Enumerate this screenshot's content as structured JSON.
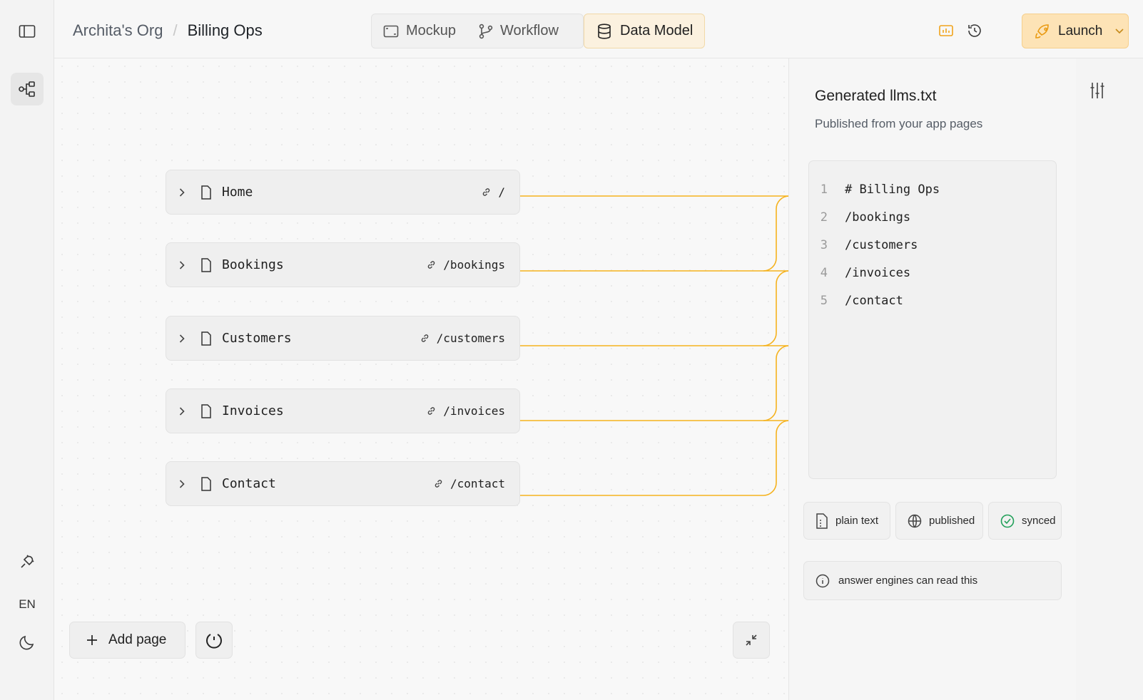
{
  "breadcrumb": {
    "org": "Archita's Org",
    "separator": "/",
    "project": "Billing Ops"
  },
  "tabs": [
    {
      "label": "Mockup",
      "icon": "mockup-icon"
    },
    {
      "label": "Workflow",
      "icon": "workflow-icon"
    },
    {
      "label": "Data Model",
      "icon": "database-icon",
      "active": true
    }
  ],
  "toolbar": {
    "launch_label": "Launch"
  },
  "rail": {
    "language": "EN"
  },
  "pages": [
    {
      "name": "Home",
      "route": "/"
    },
    {
      "name": "Bookings",
      "route": "/bookings"
    },
    {
      "name": "Customers",
      "route": "/customers"
    },
    {
      "name": "Invoices",
      "route": "/invoices"
    },
    {
      "name": "Contact",
      "route": "/contact"
    }
  ],
  "canvas": {
    "add_page_label": "Add page"
  },
  "panel": {
    "title": "Generated llms.txt",
    "subtitle": "Published from your app pages",
    "code_lines": [
      {
        "n": "1",
        "text": "# Billing Ops"
      },
      {
        "n": "2",
        "text": "/bookings"
      },
      {
        "n": "3",
        "text": "/customers"
      },
      {
        "n": "4",
        "text": "/invoices"
      },
      {
        "n": "5",
        "text": "/contact"
      }
    ],
    "chips": [
      {
        "label": "plain text",
        "icon": "file-text-icon"
      },
      {
        "label": "published",
        "icon": "globe-icon"
      },
      {
        "label": "synced",
        "icon": "check-circle-icon"
      }
    ],
    "note": "answer engines can read this"
  },
  "colors": {
    "accent": "#f5b21e",
    "launch_bg": "#fde3b6",
    "active_tab_bg": "#fbf1df",
    "synced": "#22a05a"
  }
}
